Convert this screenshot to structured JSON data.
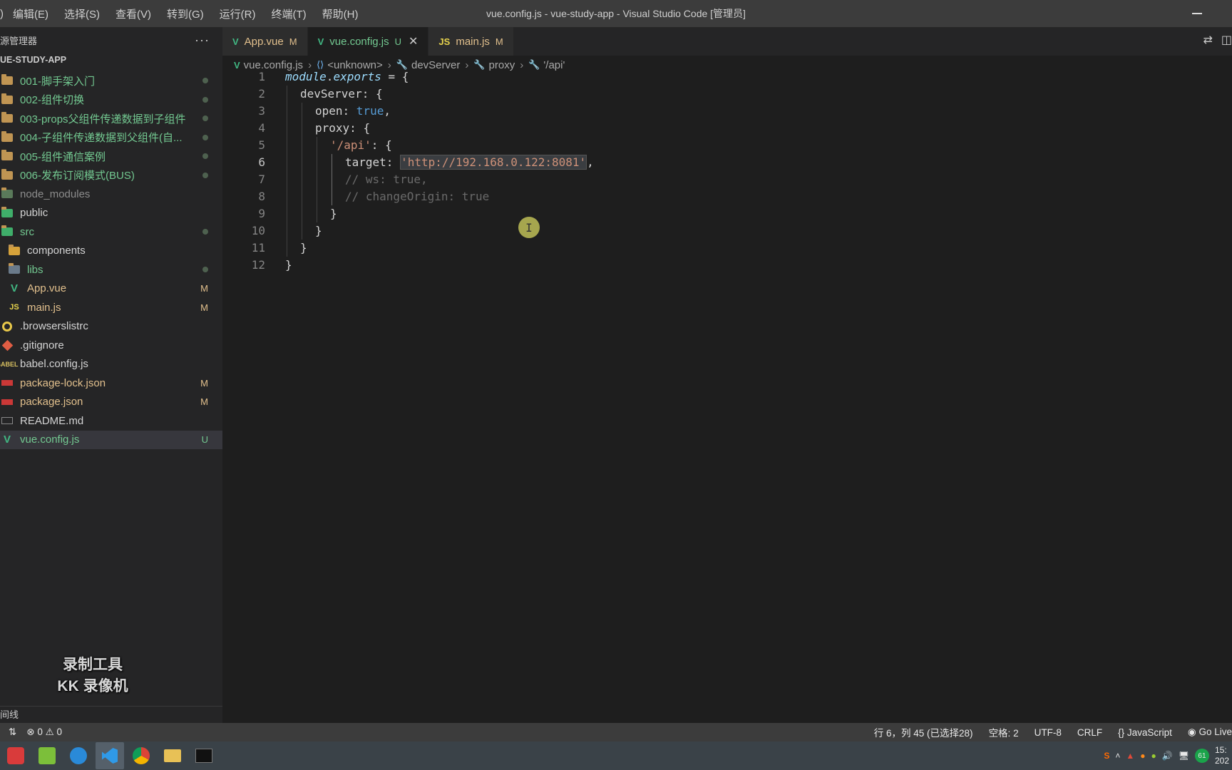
{
  "menu": [
    "编辑(E)",
    "选择(S)",
    "查看(V)",
    "转到(G)",
    "运行(R)",
    "终端(T)",
    "帮助(H)"
  ],
  "window_title": "vue.config.js - vue-study-app - Visual Studio Code [管理员]",
  "sidebar": {
    "header": "源管理器",
    "project": "UE-STUDY-APP",
    "items": [
      {
        "label": "001-脚手架入门",
        "status": ""
      },
      {
        "label": "002-组件切换",
        "status": ""
      },
      {
        "label": "003-props父组件传递数据到子组件",
        "status": ""
      },
      {
        "label": "004-子组件传递数据到父组件(自...",
        "status": ""
      },
      {
        "label": "005-组件通信案例",
        "status": ""
      },
      {
        "label": "006-发布订阅模式(BUS)",
        "status": ""
      },
      {
        "label": "node_modules",
        "status": ""
      },
      {
        "label": "public",
        "status": ""
      },
      {
        "label": "src",
        "status": ""
      },
      {
        "label": "components",
        "status": ""
      },
      {
        "label": "libs",
        "status": ""
      },
      {
        "label": "App.vue",
        "status": "M"
      },
      {
        "label": "main.js",
        "status": "M"
      },
      {
        "label": ".browserslistrc",
        "status": ""
      },
      {
        "label": ".gitignore",
        "status": ""
      },
      {
        "label": "babel.config.js",
        "status": ""
      },
      {
        "label": "package-lock.json",
        "status": "M"
      },
      {
        "label": "package.json",
        "status": "M"
      },
      {
        "label": "README.md",
        "status": ""
      },
      {
        "label": "vue.config.js",
        "status": "U"
      }
    ],
    "panel_label": "间线",
    "watermark_line1": "录制工具",
    "watermark_line2": "KK 录像机"
  },
  "tabs": [
    {
      "icon": "V",
      "label": "App.vue",
      "status": "M"
    },
    {
      "icon": "V",
      "label": "vue.config.js",
      "status": "U"
    },
    {
      "icon": "JS",
      "label": "main.js",
      "status": "M"
    }
  ],
  "breadcrumb": [
    "vue.config.js",
    "<unknown>",
    "devServer",
    "proxy",
    "'/api'"
  ],
  "editor": {
    "line_numbers": [
      "1",
      "2",
      "3",
      "4",
      "5",
      "6",
      "7",
      "8",
      "9",
      "10",
      "11",
      "12"
    ],
    "tokens": {
      "l1a": "module",
      "l1b": ".",
      "l1c": "exports",
      "l1d": " = {",
      "l2a": "devServer",
      "l2b": ": {",
      "l3a": "open",
      "l3b": ": ",
      "l3c": "true",
      "l3d": ",",
      "l4a": "proxy",
      "l4b": ": {",
      "l5a": "'/api'",
      "l5b": ": {",
      "l6a": "target",
      "l6b": ": ",
      "l6c": "'http://192.168.0.122:8081'",
      "l6d": ",",
      "l7": "// ws: true,",
      "l8": "// changeOrigin: true",
      "l9": "}",
      "l10": "}",
      "l11": "}",
      "l12": "}"
    }
  },
  "statusbar": {
    "errors": "0",
    "warnings": "0",
    "position": "行 6，列 45 (已选择28)",
    "spaces": "空格: 2",
    "encoding": "UTF-8",
    "eol": "CRLF",
    "language": "JavaScript",
    "golive": "Go Live"
  },
  "taskbar": {
    "clock_time": "15:",
    "clock_date": "202",
    "badge": "61"
  },
  "colors": {
    "accent_modified": "#e2c08d",
    "accent_untracked": "#73c991",
    "editor_bg": "#1e1e1e",
    "sidebar_bg": "#252526"
  }
}
